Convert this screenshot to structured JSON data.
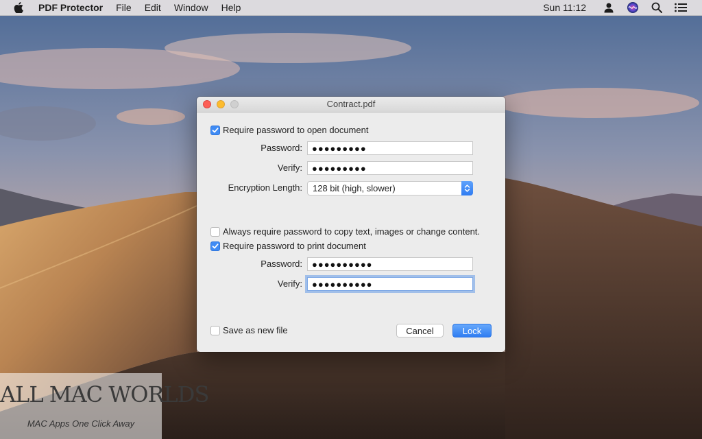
{
  "menubar": {
    "app_name": "PDF Protector",
    "menus": [
      "File",
      "Edit",
      "Window",
      "Help"
    ],
    "clock": "Sun 11:12",
    "status_icons": [
      "user-icon",
      "siri-icon",
      "search-icon",
      "list-icon"
    ]
  },
  "window": {
    "title": "Contract.pdf",
    "open_section": {
      "require_label": "Require password to open document",
      "require_checked": true,
      "password_label": "Password:",
      "password_value": "●●●●●●●●●",
      "verify_label": "Verify:",
      "verify_value": "●●●●●●●●●",
      "encryption_label": "Encryption Length:",
      "encryption_value": "128 bit (high, slower)"
    },
    "permissions": {
      "always_label": "Always require password to copy text, images or change content.",
      "always_checked": false,
      "print_label": "Require password to print document",
      "print_checked": true,
      "password_label": "Password:",
      "password_value": "●●●●●●●●●●",
      "verify_label": "Verify:",
      "verify_value": "●●●●●●●●●●"
    },
    "footer": {
      "save_new_label": "Save as new file",
      "save_new_checked": false,
      "cancel_label": "Cancel",
      "lock_label": "Lock"
    }
  },
  "watermark": {
    "title": "ALL MAC WORLDS",
    "subtitle": "MAC Apps One Click Away"
  },
  "colors": {
    "accent": "#3f8bf4",
    "close": "#fc5f57",
    "minimize": "#fdbc2e",
    "zoom_disabled": "#d0d0d0"
  }
}
